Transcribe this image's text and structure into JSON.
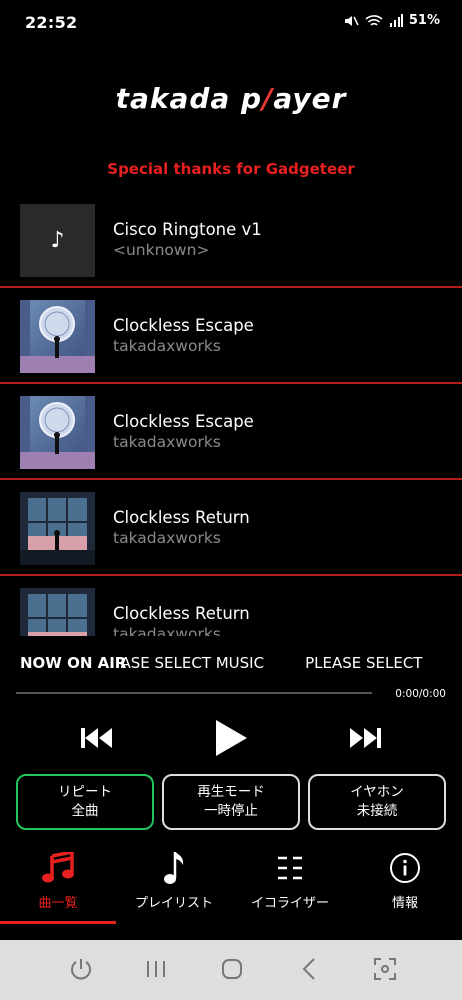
{
  "status": {
    "time": "22:52",
    "battery": "51%"
  },
  "app": {
    "logo_left": "takada p",
    "logo_slash": "/",
    "logo_right": "ayer",
    "thanks": "Special thanks for Gadgeteer"
  },
  "tracks": [
    {
      "title": "Cisco Ringtone v1",
      "artist": "<unknown>",
      "art": "note"
    },
    {
      "title": "Clockless Escape",
      "artist": "takadaxworks",
      "art": "clock"
    },
    {
      "title": "Clockless Escape",
      "artist": "takadaxworks",
      "art": "clock"
    },
    {
      "title": "Clockless Return",
      "artist": "takadaxworks",
      "art": "window"
    },
    {
      "title": "Clockless Return",
      "artist": "takadaxworks",
      "art": "window"
    }
  ],
  "now_playing": {
    "label": "NOW ON AIR",
    "marquee_1": "EASE SELECT MUSIC",
    "marquee_2": "PLEASE SELECT",
    "time": "0:00/0:00",
    "progress": 0
  },
  "controls": {
    "prev_icon": "skip-previous-icon",
    "play_icon": "play-icon",
    "next_icon": "skip-next-icon"
  },
  "modes": {
    "repeat": {
      "line1": "リピート",
      "line2": "全曲"
    },
    "playback": {
      "line1": "再生モード",
      "line2": "一時停止"
    },
    "earphone": {
      "line1": "イヤホン",
      "line2": "未接続"
    }
  },
  "nav": {
    "songs": "曲一覧",
    "playlist": "プレイリスト",
    "equalizer": "イコライザー",
    "info": "情報"
  },
  "colors": {
    "accent": "#e8201f",
    "active_border": "#22c55e",
    "divider": "#b71c1c"
  }
}
